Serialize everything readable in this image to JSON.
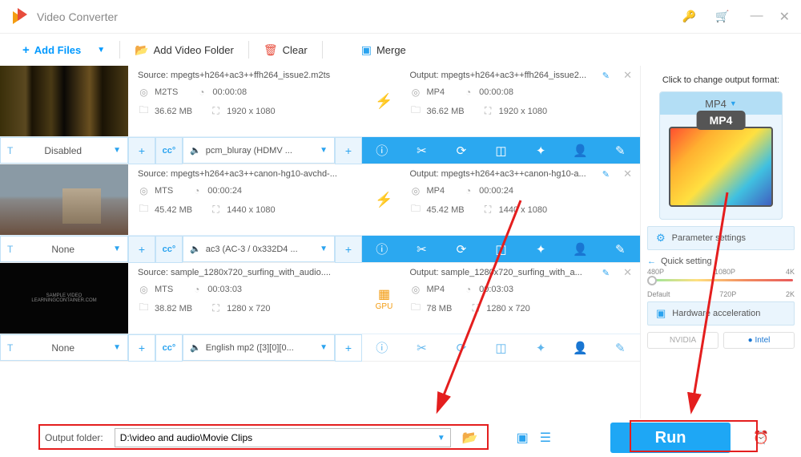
{
  "window": {
    "title": "Video Converter"
  },
  "toolbar": {
    "addFiles": "Add Files",
    "addFolder": "Add Video Folder",
    "clear": "Clear",
    "merge": "Merge"
  },
  "items": [
    {
      "source": "Source: mpegts+h264+ac3++ffh264_issue2.m2ts",
      "srcFmt": "M2TS",
      "srcDur": "00:00:08",
      "srcSize": "36.62 MB",
      "srcRes": "1920 x 1080",
      "output": "Output: mpegts+h264+ac3++ffh264_issue2...",
      "outFmt": "MP4",
      "outDur": "00:00:08",
      "outSize": "36.62 MB",
      "outRes": "1920 x 1080",
      "sub": "Disabled",
      "audio": "pcm_bluray (HDMV ..."
    },
    {
      "source": "Source: mpegts+h264+ac3++canon-hg10-avchd-...",
      "srcFmt": "MTS",
      "srcDur": "00:00:24",
      "srcSize": "45.42 MB",
      "srcRes": "1440 x 1080",
      "output": "Output: mpegts+h264+ac3++canon-hg10-a...",
      "outFmt": "MP4",
      "outDur": "00:00:24",
      "outSize": "45.42 MB",
      "outRes": "1440 x 1080",
      "sub": "None",
      "audio": "ac3 (AC-3 / 0x332D4 ..."
    },
    {
      "source": "Source: sample_1280x720_surfing_with_audio....",
      "srcFmt": "MTS",
      "srcDur": "00:03:03",
      "srcSize": "38.82 MB",
      "srcRes": "1280 x 720",
      "output": "Output: sample_1280x720_surfing_with_a...",
      "outFmt": "MP4",
      "outDur": "00:03:03",
      "outSize": "78 MB",
      "outRes": "1280 x 720",
      "sub": "None",
      "audio": "English mp2 ([3][0][0..."
    }
  ],
  "right": {
    "heading": "Click to change output format:",
    "format": "MP4",
    "param": "Parameter settings",
    "quick": "Quick setting",
    "scaleTop": [
      "480P",
      "1080P",
      "4K"
    ],
    "scaleBottom": [
      "Default",
      "720P",
      "2K"
    ],
    "hw": "Hardware acceleration",
    "nvidia": "NVIDIA",
    "intel": "Intel"
  },
  "bottom": {
    "outputFolderLabel": "Output folder:",
    "outputFolder": "D:\\video and audio\\Movie Clips",
    "run": "Run"
  }
}
